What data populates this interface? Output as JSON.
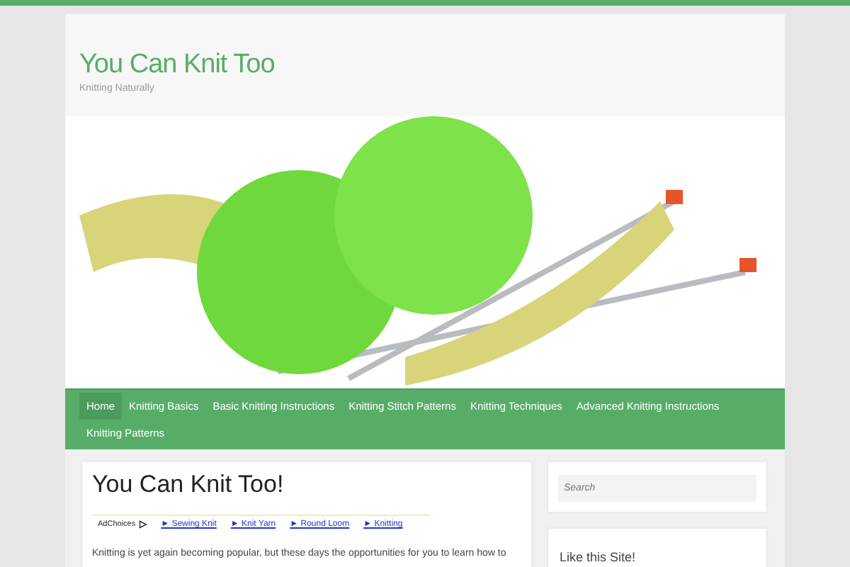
{
  "site": {
    "title": "You Can Knit Too",
    "tagline": "Knitting Naturally"
  },
  "nav": [
    {
      "label": "Home",
      "selected": true
    },
    {
      "label": "Knitting Basics",
      "selected": false
    },
    {
      "label": "Basic Knitting Instructions",
      "selected": false
    },
    {
      "label": "Knitting Stitch Patterns",
      "selected": false
    },
    {
      "label": "Knitting Techniques",
      "selected": false
    },
    {
      "label": "Advanced Knitting Instructions",
      "selected": false
    },
    {
      "label": "Knitting Patterns",
      "selected": false
    }
  ],
  "post": {
    "title": "You Can Knit Too!",
    "ad_label": "AdChoices",
    "ad_links": [
      "► Sewing Knit",
      "► Knit Yarn",
      "► Round Loom",
      "► Knitting"
    ],
    "body": "Knitting is yet again becoming popular, but these days the opportunities for you to learn how to"
  },
  "sidebar": {
    "search": {
      "placeholder": "Search"
    },
    "widget_title": "Like this Site!"
  }
}
